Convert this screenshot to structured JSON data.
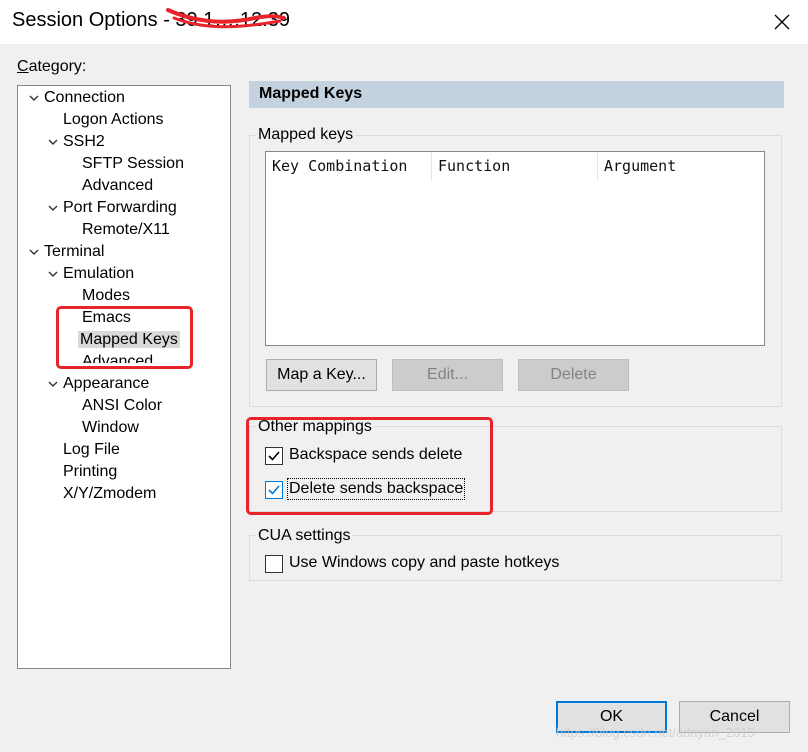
{
  "window": {
    "title": "Session Options - 39.1….12.39",
    "accent": "#0078d7",
    "annotation_color": "#e8232a"
  },
  "category": {
    "label": "Category:",
    "tree": [
      {
        "label": "Connection",
        "expanded": true
      },
      {
        "label": "Logon Actions"
      },
      {
        "label": "SSH2",
        "expanded": true
      },
      {
        "label": "SFTP Session"
      },
      {
        "label": "Advanced"
      },
      {
        "label": "Port Forwarding",
        "expanded": true
      },
      {
        "label": "Remote/X11"
      },
      {
        "label": "Terminal",
        "expanded": true
      },
      {
        "label": "Emulation",
        "expanded": true
      },
      {
        "label": "Modes"
      },
      {
        "label": "Emacs"
      },
      {
        "label": "Mapped Keys",
        "selected": true
      },
      {
        "label": "Advanced"
      },
      {
        "label": "Appearance",
        "expanded": true
      },
      {
        "label": "ANSI Color"
      },
      {
        "label": "Window"
      },
      {
        "label": "Log File"
      },
      {
        "label": "Printing"
      },
      {
        "label": "X/Y/Zmodem"
      }
    ]
  },
  "panel": {
    "header": "Mapped Keys",
    "mapped_keys": {
      "group_label": "Mapped keys",
      "columns": [
        "Key Combination",
        "Function",
        "Argument"
      ],
      "rows": [],
      "buttons": {
        "map": "Map a Key...",
        "edit": "Edit...",
        "delete": "Delete"
      }
    },
    "other": {
      "group_label": "Other mappings",
      "backspace_label": "Backspace sends delete",
      "backspace_checked": true,
      "delete_label": "Delete sends backspace",
      "delete_checked": true
    },
    "cua": {
      "group_label": "CUA settings",
      "windows_label": "Use Windows copy and paste hotkeys",
      "windows_checked": false
    }
  },
  "footer": {
    "ok": "OK",
    "cancel": "Cancel"
  },
  "watermark": "https://blog.csdn.net/adayan_2015"
}
